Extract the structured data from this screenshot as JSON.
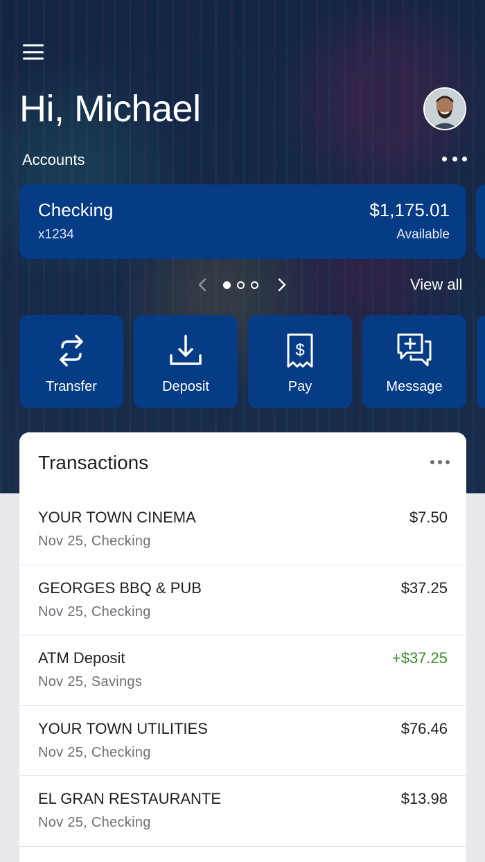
{
  "header": {
    "greeting": "Hi, Michael",
    "accounts_label": "Accounts"
  },
  "account": {
    "name": "Checking",
    "mask": "x1234",
    "balance": "$1,175.01",
    "balance_label": "Available"
  },
  "pager": {
    "total_pages": 3,
    "active_index": 0,
    "view_all_label": "View all"
  },
  "actions": [
    {
      "label": "Transfer",
      "icon": "transfer-icon"
    },
    {
      "label": "Deposit",
      "icon": "deposit-icon"
    },
    {
      "label": "Pay",
      "icon": "pay-bill-icon"
    },
    {
      "label": "Message",
      "icon": "message-icon"
    }
  ],
  "transactions": {
    "title": "Transactions",
    "items": [
      {
        "merchant": "YOUR TOWN CINEMA",
        "meta": "Nov 25, Checking",
        "amount": "$7.50",
        "credit": false
      },
      {
        "merchant": "GEORGES BBQ & PUB",
        "meta": "Nov 25, Checking",
        "amount": "$37.25",
        "credit": false
      },
      {
        "merchant": "ATM Deposit",
        "meta": "Nov 25, Savings",
        "amount": "+$37.25",
        "credit": true
      },
      {
        "merchant": "YOUR TOWN UTILITIES",
        "meta": "Nov 25, Checking",
        "amount": "$76.46",
        "credit": false
      },
      {
        "merchant": "EL GRAN RESTAURANTE",
        "meta": "Nov 25, Checking",
        "amount": "$13.98",
        "credit": false
      }
    ]
  },
  "colors": {
    "brand_blue": "#063b86",
    "credit_green": "#3b8a26",
    "muted_text": "#6b6f76"
  }
}
